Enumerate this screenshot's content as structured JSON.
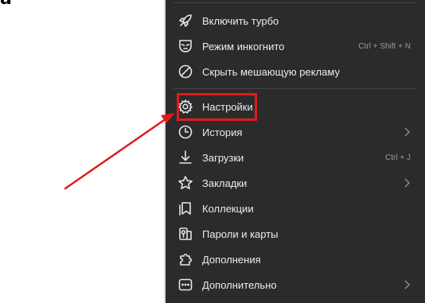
{
  "page": {
    "fragment_text": "a"
  },
  "menu": {
    "items": [
      {
        "label": "Включить турбо",
        "shortcut": "",
        "submenu": false,
        "icon": "rocket-icon"
      },
      {
        "label": "Режим инкогнито",
        "shortcut": "Ctrl + Shift + N",
        "submenu": false,
        "icon": "incognito-mask-icon"
      },
      {
        "label": "Скрыть мешающую рекламу",
        "shortcut": "",
        "submenu": false,
        "icon": "block-ads-icon"
      },
      {
        "label": "Настройки",
        "shortcut": "",
        "submenu": false,
        "icon": "gear-icon"
      },
      {
        "label": "История",
        "shortcut": "",
        "submenu": true,
        "icon": "clock-icon"
      },
      {
        "label": "Загрузки",
        "shortcut": "Ctrl + J",
        "submenu": false,
        "icon": "download-icon"
      },
      {
        "label": "Закладки",
        "shortcut": "",
        "submenu": true,
        "icon": "star-icon"
      },
      {
        "label": "Коллекции",
        "shortcut": "",
        "submenu": false,
        "icon": "collections-icon"
      },
      {
        "label": "Пароли и карты",
        "shortcut": "",
        "submenu": false,
        "icon": "key-card-icon"
      },
      {
        "label": "Дополнения",
        "shortcut": "",
        "submenu": false,
        "icon": "puzzle-icon"
      },
      {
        "label": "Дополнительно",
        "shortcut": "",
        "submenu": true,
        "icon": "more-dots-icon"
      }
    ]
  },
  "annotation": {
    "highlight_color": "#e01b1b",
    "arrow_color": "#e01b1b",
    "target": "Настройки"
  }
}
